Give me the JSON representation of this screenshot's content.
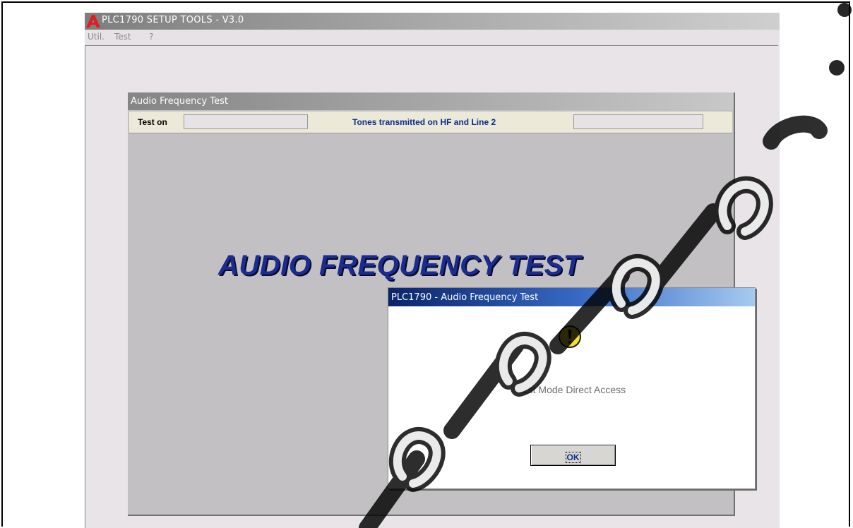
{
  "app": {
    "title": "PLC1790 SETUP TOOLS  -  V3.0",
    "menu": [
      "Util.",
      "Test",
      "?"
    ]
  },
  "aft_window": {
    "title": "Audio Frequency Test",
    "test_on_label": "Test on",
    "test_on_value": "",
    "status_text": "Tones transmitted on HF and Line 2",
    "right_value": "",
    "banner": "AUDIO FREQUENCY TEST"
  },
  "dialog": {
    "title": "PLC1790 - Audio Frequency Test",
    "icon": "warning-icon",
    "message": "Test Mode Direct Access",
    "ok_label": "OK"
  },
  "colors": {
    "banner_text": "#1c2c8e",
    "status_text": "#0c2a8a",
    "dialog_titlebar": "#0a246a",
    "watermark": "#000000"
  }
}
